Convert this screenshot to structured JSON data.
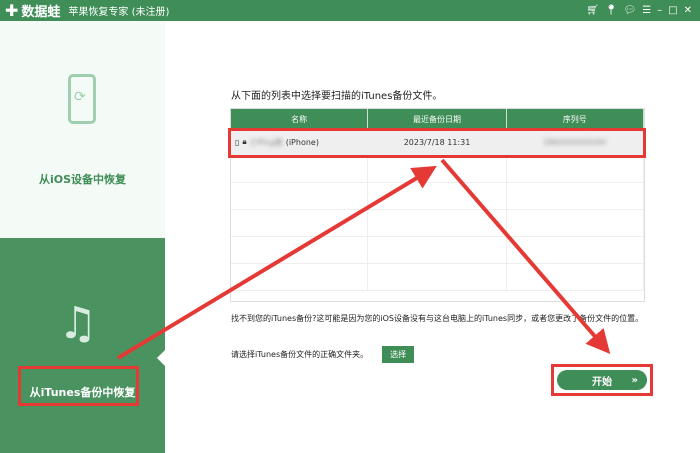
{
  "titlebar": {
    "brand": "数据蛙",
    "title": "苹果恢复专家 (未注册)",
    "icons": [
      "cart-icon",
      "pin-icon",
      "chat-icon",
      "menu-icon",
      "minimize-icon",
      "maximize-icon",
      "close-icon"
    ]
  },
  "sidebar": {
    "items": [
      {
        "label": "从iOS设备中恢复"
      },
      {
        "label": "从iTunes备份中恢复"
      }
    ]
  },
  "main": {
    "instruction": "从下面的列表中选择要扫描的iTunes备份文件。",
    "table": {
      "headers": [
        "名称",
        "最近备份日期",
        "序列号"
      ],
      "rows": [
        {
          "name": "(iPhone)",
          "name_blurred": "小Ping桑",
          "date": "2023/7/18 11:31",
          "serial": "DNXXXXXXXXH"
        }
      ]
    },
    "hint": "找不到您的iTunes备份?这可能是因为您的iOS设备没有与这台电脑上的iTunes同步，或者您更改了备份文件的位置。",
    "choose_prompt": "请选择iTunes备份文件的正确文件夹。",
    "choose_button": "选择",
    "start_button": "开始",
    "start_chevron": "»"
  },
  "colors": {
    "brand": "#3f8d57",
    "highlight": "#e53935"
  }
}
